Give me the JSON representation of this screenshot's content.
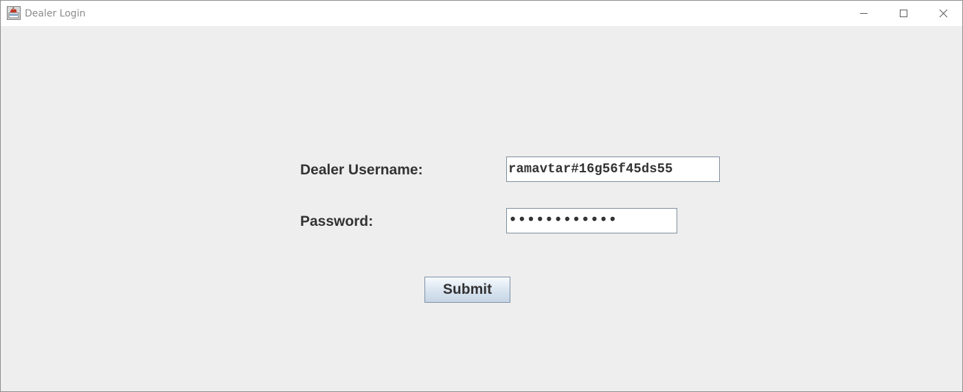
{
  "window": {
    "title": "Dealer Login",
    "app_icon": "java-app-icon",
    "controls": {
      "minimize_icon": "minimize-icon",
      "maximize_icon": "maximize-icon",
      "close_icon": "close-icon"
    }
  },
  "form": {
    "username_label": "Dealer Username:",
    "username_value": "ramavtar#16g56f45ds55",
    "password_label": "Password:",
    "password_masked": "••••••••••••",
    "submit_label": "Submit"
  },
  "colors": {
    "background": "#eeeeee",
    "titlebar": "#ffffff",
    "text": "#333333",
    "field_border": "#7a8a99"
  }
}
